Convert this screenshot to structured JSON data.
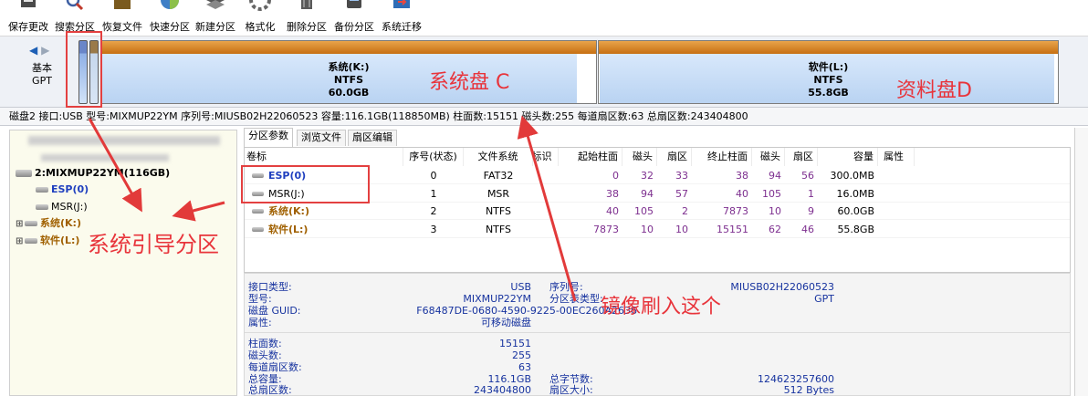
{
  "toolbar": {
    "buttons": [
      {
        "label": "保存更改",
        "icon": "save-icon"
      },
      {
        "label": "搜索分区",
        "icon": "search-icon"
      },
      {
        "label": "恢复文件",
        "icon": "recover-files-icon"
      },
      {
        "label": "快速分区",
        "icon": "quick-partition-icon"
      },
      {
        "label": "新建分区",
        "icon": "new-partition-icon"
      },
      {
        "label": "格式化",
        "icon": "format-icon"
      },
      {
        "label": "删除分区",
        "icon": "delete-icon"
      },
      {
        "label": "备份分区",
        "icon": "backup-icon"
      },
      {
        "label": "系统迁移",
        "icon": "migrate-icon"
      }
    ]
  },
  "disk_map": {
    "disk_label": "基本",
    "disk_type": "GPT",
    "partitions": [
      {
        "name": "系统(K:)",
        "fs": "NTFS",
        "size": "60.0GB"
      },
      {
        "name": "软件(L:)",
        "fs": "NTFS",
        "size": "55.8GB"
      }
    ]
  },
  "disk_info": "磁盘2 接口:USB  型号:MIXMUP22YM  序列号:MIUSB02H22060523  容量:116.1GB(118850MB)  柱面数:15151  磁头数:255  每道扇区数:63  总扇区数:243404800",
  "tree": {
    "disk_item": "2:MIXMUP22YM(116GB)",
    "items": [
      {
        "label": "ESP(0)",
        "color": "#1f3fbf"
      },
      {
        "label": "MSR(J:)",
        "color": "#000000"
      },
      {
        "label": "系统(K:)",
        "color": "#a06000"
      },
      {
        "label": "软件(L:)",
        "color": "#a06000"
      }
    ]
  },
  "tabs": [
    "分区参数",
    "浏览文件",
    "扇区编辑"
  ],
  "table": {
    "headers": [
      "卷标",
      "序号(状态)",
      "文件系统",
      "标识",
      "起始柱面",
      "磁头",
      "扇区",
      "终止柱面",
      "磁头",
      "扇区",
      "容量",
      "属性"
    ],
    "rows": [
      {
        "label": "ESP(0)",
        "color": "#1f3fbf",
        "num": "0",
        "fs": "FAT32",
        "start_cyl": "0",
        "start_head": "32",
        "start_sec": "33",
        "end_cyl": "38",
        "end_head": "94",
        "end_sec": "56",
        "size": "300.0MB"
      },
      {
        "label": "MSR(J:)",
        "color": "#000000",
        "num": "1",
        "fs": "MSR",
        "start_cyl": "38",
        "start_head": "94",
        "start_sec": "57",
        "end_cyl": "40",
        "end_head": "105",
        "end_sec": "1",
        "size": "16.0MB"
      },
      {
        "label": "系统(K:)",
        "color": "#a06000",
        "num": "2",
        "fs": "NTFS",
        "start_cyl": "40",
        "start_head": "105",
        "start_sec": "2",
        "end_cyl": "7873",
        "end_head": "10",
        "end_sec": "9",
        "size": "60.0GB"
      },
      {
        "label": "软件(L:)",
        "color": "#a06000",
        "num": "3",
        "fs": "NTFS",
        "start_cyl": "7873",
        "start_head": "10",
        "start_sec": "10",
        "end_cyl": "15151",
        "end_head": "62",
        "end_sec": "46",
        "size": "55.8GB"
      }
    ]
  },
  "props": {
    "iface_k": "接口类型:",
    "iface_v": "USB",
    "serial_k": "序列号:",
    "serial_v": "MIUSB02H22060523",
    "model_k": "型号:",
    "model_v": "MIXMUP22YM",
    "ptype_k": "分区表类型:",
    "ptype_v": "GPT",
    "guid_k": "磁盘 GUID:",
    "guid_v": "F68487DE-0680-4590-9225-00EC260A2636",
    "attr_k": "属性:",
    "attr_v": "可移动磁盘",
    "cyl_k": "柱面数:",
    "cyl_v": "15151",
    "heads_k": "磁头数:",
    "heads_v": "255",
    "spt_k": "每道扇区数:",
    "spt_v": "63",
    "cap_k": "总容量:",
    "cap_v": "116.1GB",
    "bytes_k": "总字节数:",
    "bytes_v": "124623257600",
    "sect_k": "总扇区数:",
    "sect_v": "243404800",
    "ssize_k": "扇区大小:",
    "ssize_v": "512 Bytes"
  },
  "annotations": {
    "sys_disk": "系统盘 C",
    "data_disk": "资料盘D",
    "boot_partition": "系统引导分区",
    "mirror": "镜像刷入这个"
  },
  "colors": {
    "annotation_red": "#e8343b",
    "orange_bar": "#d9852c"
  }
}
